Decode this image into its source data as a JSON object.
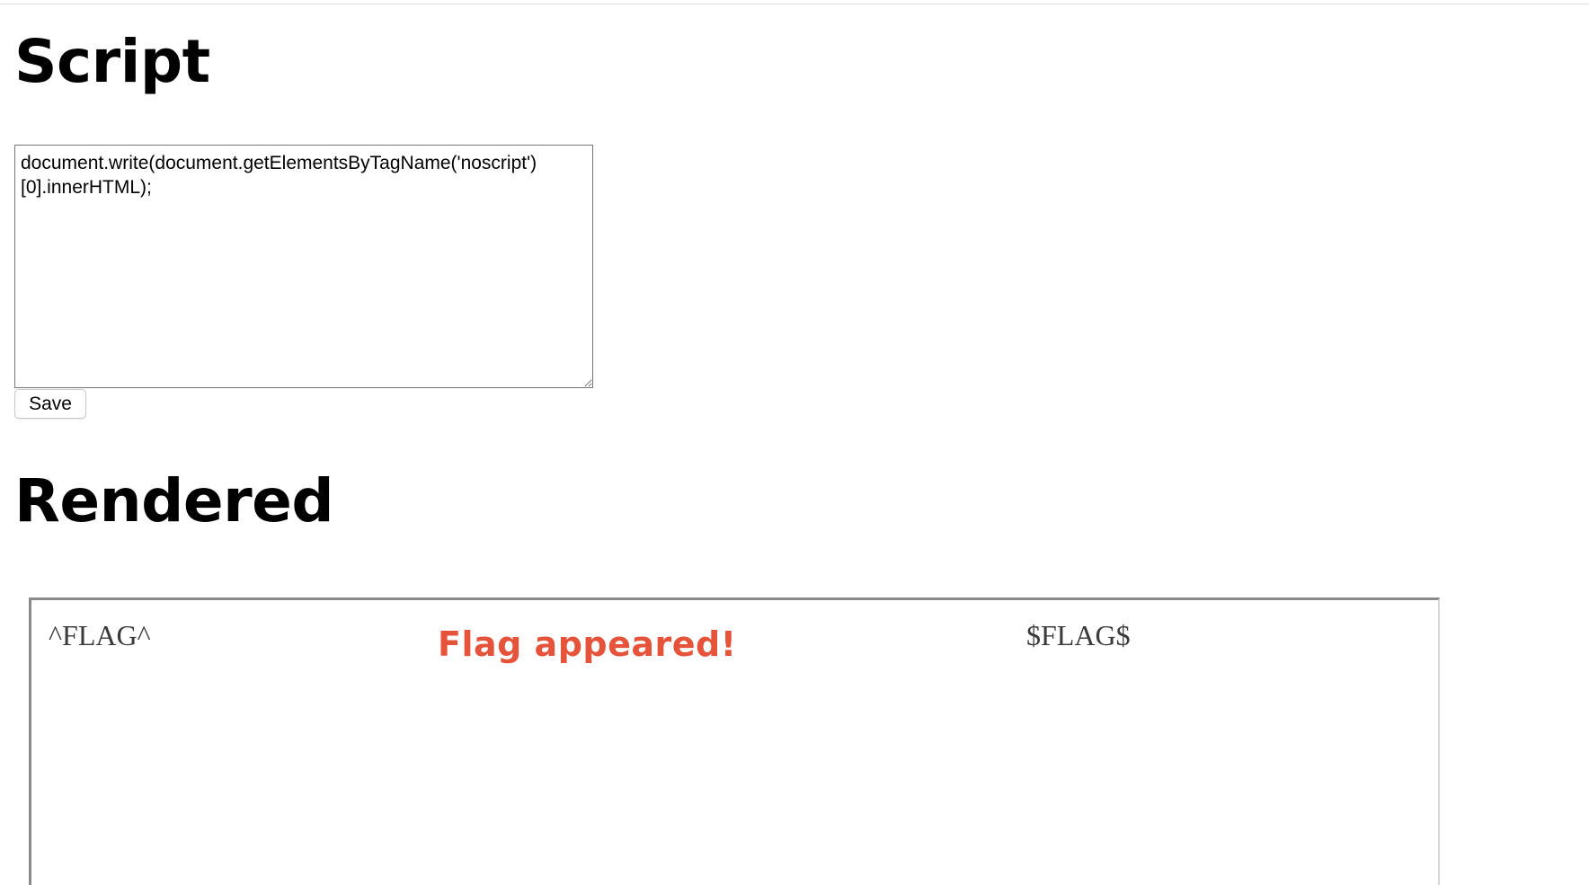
{
  "headings": {
    "script": "Script",
    "rendered": "Rendered"
  },
  "script_editor": {
    "value": "document.write(document.getElementsByTagName('noscript')[0].innerHTML);"
  },
  "save_button": {
    "label": "Save"
  },
  "rendered_frame": {
    "flag_start": "^FLAG^",
    "flag_end": "$FLAG$",
    "annotation": "Flag appeared!",
    "annotation_color": "#e5533a"
  }
}
